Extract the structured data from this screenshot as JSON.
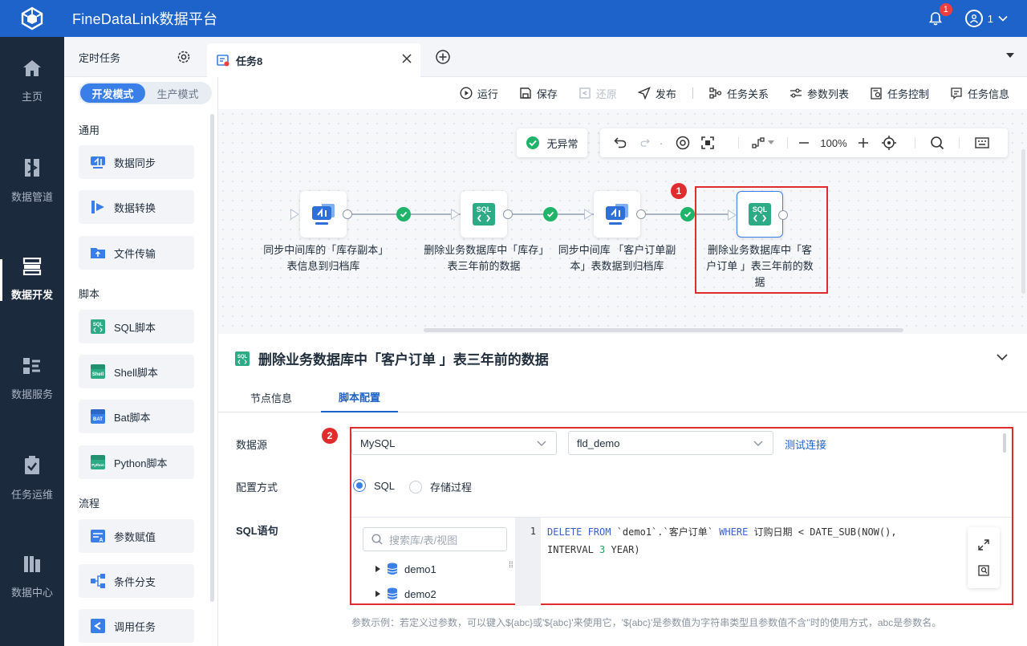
{
  "app": {
    "title": "FineDataLink数据平台",
    "notification_count": "1",
    "user_name": "1"
  },
  "nav": [
    {
      "label": "主页",
      "icon": "home-icon"
    },
    {
      "label": "数据管道",
      "icon": "pipeline-icon"
    },
    {
      "label": "数据开发",
      "icon": "dev-icon",
      "active": true
    },
    {
      "label": "数据服务",
      "icon": "service-icon"
    },
    {
      "label": "任务运维",
      "icon": "ops-icon"
    },
    {
      "label": "数据中心",
      "icon": "datacenter-icon"
    }
  ],
  "tabs": {
    "scheduled": "定时任务",
    "current": "任务8"
  },
  "modes": {
    "dev": "开发模式",
    "prod": "生产模式"
  },
  "components": {
    "general_title": "通用",
    "general": [
      "数据同步",
      "数据转换",
      "文件传输"
    ],
    "script_title": "脚本",
    "scripts": [
      "SQL脚本",
      "Shell脚本",
      "Bat脚本",
      "Python脚本"
    ],
    "flow_title": "流程",
    "flow": [
      "参数赋值",
      "条件分支",
      "调用任务"
    ]
  },
  "toolbar": {
    "run": "运行",
    "save": "保存",
    "restore": "还原",
    "publish": "发布",
    "relation": "任务关系",
    "params": "参数列表",
    "control": "任务控制",
    "info": "任务信息"
  },
  "canvas": {
    "status": "无异常",
    "zoom": "100%",
    "marker1": "1",
    "nodes": [
      {
        "label": "同步中间库的「库存副本」表信息到归档库",
        "type": "sync"
      },
      {
        "label": "删除业务数据库中「库存」表三年前的数据",
        "type": "sql"
      },
      {
        "label": "同步中间库 「客户订单副本」表数据到归档库",
        "type": "sync"
      },
      {
        "label": "删除业务数据库中「客户订单 」表三年前的数据",
        "type": "sql"
      }
    ]
  },
  "panel": {
    "title": "删除业务数据库中「客户订单 」表三年前的数据",
    "tab_info": "节点信息",
    "tab_script": "脚本配置",
    "marker2": "2",
    "datasource_label": "数据源",
    "datasource_type": "MySQL",
    "datasource_db": "fld_demo",
    "test_link": "测试连接",
    "config_label": "配置方式",
    "opt_sql": "SQL",
    "opt_proc": "存储过程",
    "sql_label": "SQL语句",
    "search_placeholder": "搜索库/表/视图",
    "tree": [
      "demo1",
      "demo2"
    ],
    "line_no": "1",
    "code_line1_a": "DELETE FROM",
    "code_line1_b": " `demo1`.`客户订单` ",
    "code_line1_c": "WHERE",
    "code_line1_d": " 订购日期 < DATE_SUB(NOW(),",
    "code_line2_a": "INTERVAL ",
    "code_line2_b": "3",
    "code_line2_c": " YEAR)",
    "hint": "参数示例：若定义过参数，可以键入${abc}或'${abc}'来使用它，'${abc}'是参数值为字符串类型且参数值不含''时的使用方式，abc是参数名。"
  },
  "colors": {
    "primary": "#1e63c9",
    "nav_bg": "#1c2a3e",
    "success": "#20b46a",
    "highlight": "#e02c2c"
  }
}
